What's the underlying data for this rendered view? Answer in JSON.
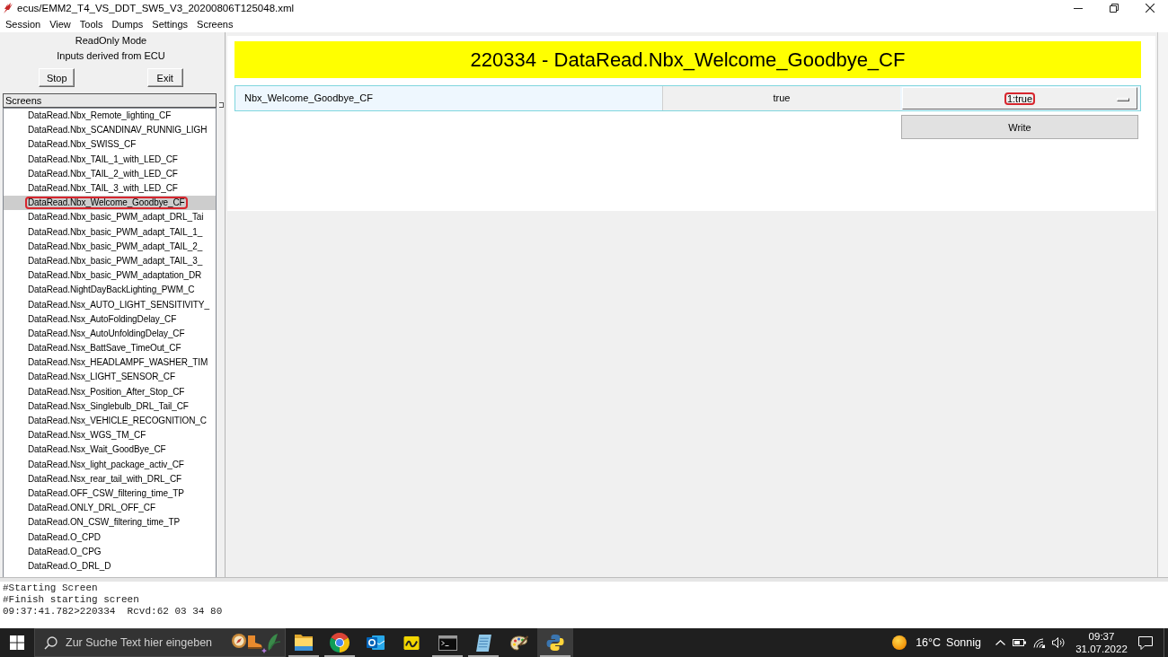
{
  "window": {
    "title": "ecus/EMM2_T4_VS_DDT_SW5_V3_20200806T125048.xml"
  },
  "menu": [
    "Session",
    "View",
    "Tools",
    "Dumps",
    "Settings",
    "Screens"
  ],
  "sidebar": {
    "mode": "ReadOnly Mode",
    "source": "Inputs derived from ECU",
    "buttons": [
      "Stop",
      "Exit"
    ],
    "list_title": "Screens",
    "items": [
      {
        "label": "DataRead.Nbx_Remote_lighting_CF",
        "selected": false,
        "circled": false
      },
      {
        "label": "DataRead.Nbx_SCANDINAV_RUNNIG_LIGH",
        "selected": false,
        "circled": false
      },
      {
        "label": "DataRead.Nbx_SWISS_CF",
        "selected": false,
        "circled": false
      },
      {
        "label": "DataRead.Nbx_TAIL_1_with_LED_CF",
        "selected": false,
        "circled": false
      },
      {
        "label": "DataRead.Nbx_TAIL_2_with_LED_CF",
        "selected": false,
        "circled": false
      },
      {
        "label": "DataRead.Nbx_TAIL_3_with_LED_CF",
        "selected": false,
        "circled": false
      },
      {
        "label": "DataRead.Nbx_Welcome_Goodbye_CF",
        "selected": true,
        "circled": true
      },
      {
        "label": "DataRead.Nbx_basic_PWM_adapt_DRL_Tai",
        "selected": false,
        "circled": false
      },
      {
        "label": "DataRead.Nbx_basic_PWM_adapt_TAIL_1_",
        "selected": false,
        "circled": false
      },
      {
        "label": "DataRead.Nbx_basic_PWM_adapt_TAIL_2_",
        "selected": false,
        "circled": false
      },
      {
        "label": "DataRead.Nbx_basic_PWM_adapt_TAIL_3_",
        "selected": false,
        "circled": false
      },
      {
        "label": "DataRead.Nbx_basic_PWM_adaptation_DR",
        "selected": false,
        "circled": false
      },
      {
        "label": "DataRead.NightDayBackLighting_PWM_C",
        "selected": false,
        "circled": false
      },
      {
        "label": "DataRead.Nsx_AUTO_LIGHT_SENSITIVITY_",
        "selected": false,
        "circled": false
      },
      {
        "label": "DataRead.Nsx_AutoFoldingDelay_CF",
        "selected": false,
        "circled": false
      },
      {
        "label": "DataRead.Nsx_AutoUnfoldingDelay_CF",
        "selected": false,
        "circled": false
      },
      {
        "label": "DataRead.Nsx_BattSave_TimeOut_CF",
        "selected": false,
        "circled": false
      },
      {
        "label": "DataRead.Nsx_HEADLAMPF_WASHER_TIM",
        "selected": false,
        "circled": false
      },
      {
        "label": "DataRead.Nsx_LIGHT_SENSOR_CF",
        "selected": false,
        "circled": false
      },
      {
        "label": "DataRead.Nsx_Position_After_Stop_CF",
        "selected": false,
        "circled": false
      },
      {
        "label": "DataRead.Nsx_Singlebulb_DRL_Tail_CF",
        "selected": false,
        "circled": false
      },
      {
        "label": "DataRead.Nsx_VEHICLE_RECOGNITION_C",
        "selected": false,
        "circled": false
      },
      {
        "label": "DataRead.Nsx_WGS_TM_CF",
        "selected": false,
        "circled": false
      },
      {
        "label": "DataRead.Nsx_Wait_GoodBye_CF",
        "selected": false,
        "circled": false
      },
      {
        "label": "DataRead.Nsx_light_package_activ_CF",
        "selected": false,
        "circled": false
      },
      {
        "label": "DataRead.Nsx_rear_tail_with_DRL_CF",
        "selected": false,
        "circled": false
      },
      {
        "label": "DataRead.OFF_CSW_filtering_time_TP",
        "selected": false,
        "circled": false
      },
      {
        "label": "DataRead.ONLY_DRL_OFF_CF",
        "selected": false,
        "circled": false
      },
      {
        "label": "DataRead.ON_CSW_filtering_time_TP",
        "selected": false,
        "circled": false
      },
      {
        "label": "DataRead.O_CPD",
        "selected": false,
        "circled": false
      },
      {
        "label": "DataRead.O_CPG",
        "selected": false,
        "circled": false
      },
      {
        "label": "DataRead.O_DRL_D",
        "selected": false,
        "circled": false
      }
    ]
  },
  "screen": {
    "title": "220334 - DataRead.Nbx_Welcome_Goodbye_CF",
    "params": [
      {
        "name": "Nbx_Welcome_Goodbye_CF",
        "value": "true",
        "choice": "1:true",
        "choice_circled": true
      }
    ],
    "write_button": "Write"
  },
  "log": [
    "#Starting Screen",
    "#Finish starting screen",
    "09:37:41.782>220334  Rcvd:62 03 34 80"
  ],
  "taskbar": {
    "search": {
      "placeholder": "Zur Suche Text hier eingeben"
    },
    "apps": [
      {
        "kind": "files",
        "selected": false,
        "running": true
      },
      {
        "kind": "browser",
        "selected": false,
        "running": true
      },
      {
        "kind": "mail",
        "selected": false,
        "running": false
      },
      {
        "kind": "reader",
        "selected": false,
        "running": false
      },
      {
        "kind": "terminal",
        "selected": false,
        "running": true
      },
      {
        "kind": "editor",
        "selected": false,
        "running": true
      },
      {
        "kind": "paint",
        "selected": false,
        "running": false
      },
      {
        "kind": "python",
        "selected": true,
        "running": true
      }
    ],
    "weather": {
      "temperature": "16°C",
      "condition": "Sonnig"
    },
    "time": "09:37",
    "date": "31.07.2022"
  }
}
